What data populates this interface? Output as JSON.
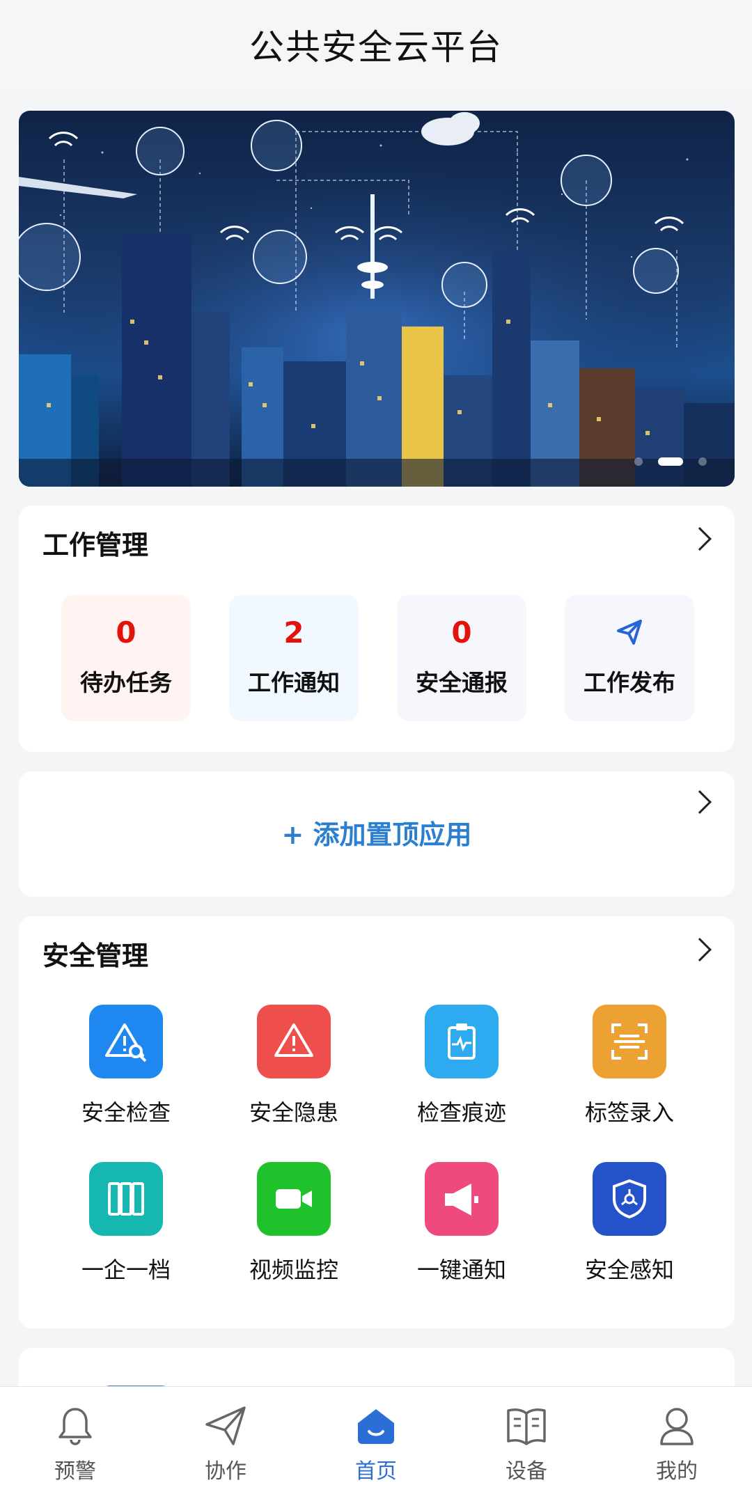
{
  "header": {
    "title": "公共安全云平台"
  },
  "banner": {
    "dots": 3,
    "active_dot": 2
  },
  "work": {
    "title": "工作管理",
    "tiles": [
      {
        "value": "0",
        "label": "待办任务",
        "bg": "#fff4f1"
      },
      {
        "value": "2",
        "label": "工作通知",
        "bg": "#f1f8ff"
      },
      {
        "value": "0",
        "label": "安全通报",
        "bg": "#f5f7fc"
      },
      {
        "value": "",
        "label": "工作发布",
        "bg": "#f5f7fc",
        "icon": "send-icon"
      }
    ]
  },
  "pinned": {
    "add_label": "+ 添加置顶应用"
  },
  "safety": {
    "title": "安全管理",
    "items": [
      {
        "label": "安全检查",
        "icon": "warning-search-icon",
        "color": "#1e88f0"
      },
      {
        "label": "安全隐患",
        "icon": "warning-icon",
        "color": "#ee4e4c"
      },
      {
        "label": "检查痕迹",
        "icon": "clipboard-pulse-icon",
        "color": "#2eaaf0"
      },
      {
        "label": "标签录入",
        "icon": "scan-icon",
        "color": "#eca232"
      },
      {
        "label": "一企一档",
        "icon": "binders-icon",
        "color": "#16b7b0"
      },
      {
        "label": "视频监控",
        "icon": "video-camera-icon",
        "color": "#1fc22a"
      },
      {
        "label": "一键通知",
        "icon": "megaphone-icon",
        "color": "#ef4a7e"
      },
      {
        "label": "安全感知",
        "icon": "shield-network-icon",
        "color": "#2452c8"
      }
    ]
  },
  "nav": {
    "items": [
      {
        "label": "预警",
        "icon": "bell-icon"
      },
      {
        "label": "协作",
        "icon": "paper-plane-icon"
      },
      {
        "label": "首页",
        "icon": "home-icon",
        "active": true
      },
      {
        "label": "设备",
        "icon": "book-icon"
      },
      {
        "label": "我的",
        "icon": "user-icon"
      }
    ],
    "active_color": "#2b6fd6"
  }
}
